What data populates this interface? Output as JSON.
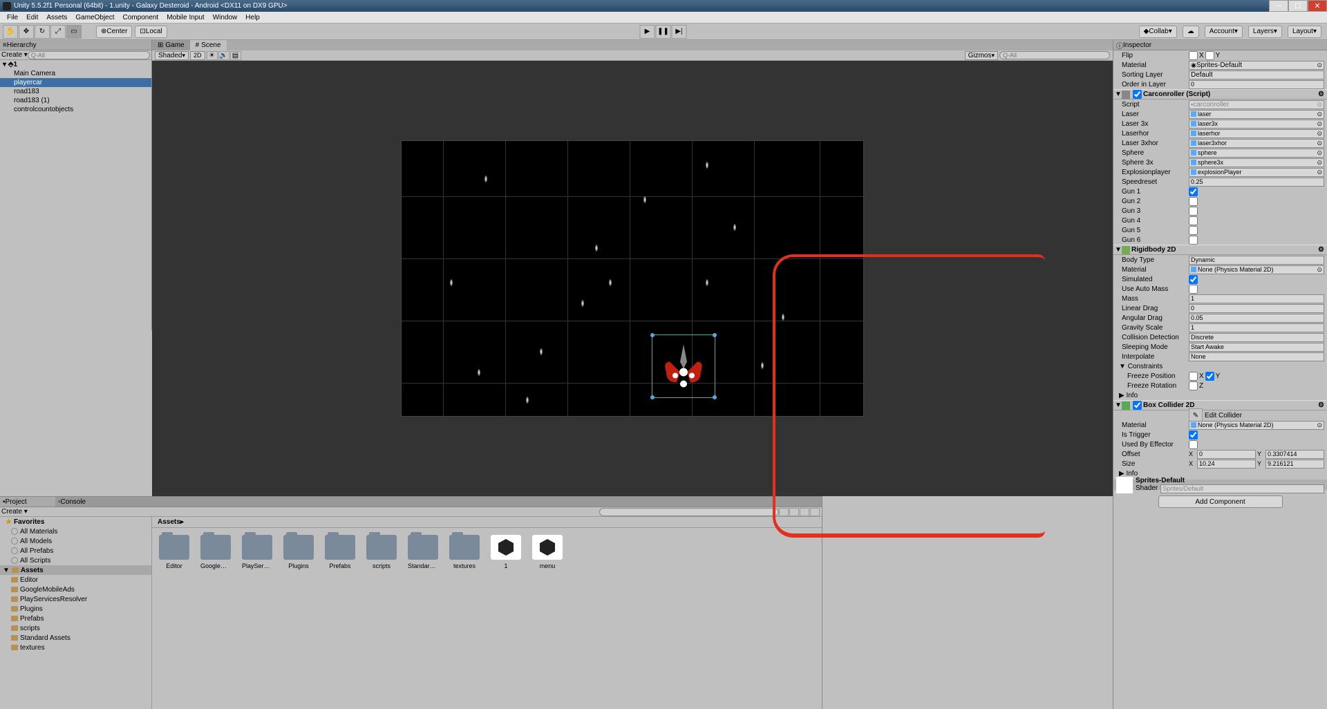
{
  "title": "Unity 5.5.2f1 Personal (64bit) - 1.unity - Galaxy Desteroid - Android <DX11 on DX9 GPU>",
  "menus": [
    "File",
    "Edit",
    "Assets",
    "GameObject",
    "Component",
    "Mobile Input",
    "Window",
    "Help"
  ],
  "toolbar": {
    "center": "Center",
    "local": "Local",
    "collab": "Collab",
    "account": "Account",
    "layers": "Layers",
    "layout": "Layout"
  },
  "hierarchy": {
    "title": "Hierarchy",
    "create": "Create",
    "search": "Q-All",
    "scene": "1",
    "items": [
      "Main Camera",
      "playercar",
      "road183",
      "road183 (1)",
      "controlcountobjects"
    ],
    "selected": 1
  },
  "scene": {
    "tabs": [
      "Game",
      "Scene"
    ],
    "active": 1,
    "shaded": "Shaded",
    "mode2d": "2D",
    "gizmos": "Gizmos",
    "search": "Q-All"
  },
  "project": {
    "title": "Project",
    "console": "Console",
    "create": "Create",
    "favorites": "Favorites",
    "favitems": [
      "All Materials",
      "All Models",
      "All Prefabs",
      "All Scripts"
    ],
    "assets": "Assets",
    "folders": [
      "Editor",
      "GoogleMobileAds",
      "PlayServicesResolver",
      "Plugins",
      "Prefabs",
      "scripts",
      "Standard Assets",
      "textures"
    ],
    "breadcrumb": "Assets",
    "griditems": [
      {
        "n": "Editor",
        "t": "folder"
      },
      {
        "n": "GoogleMobi...",
        "t": "folder"
      },
      {
        "n": "PlayServic...",
        "t": "folder"
      },
      {
        "n": "Plugins",
        "t": "folder"
      },
      {
        "n": "Prefabs",
        "t": "folder"
      },
      {
        "n": "scripts",
        "t": "folder"
      },
      {
        "n": "Standard A...",
        "t": "folder"
      },
      {
        "n": "textures",
        "t": "folder"
      },
      {
        "n": "1",
        "t": "unity"
      },
      {
        "n": "menu",
        "t": "unity"
      }
    ]
  },
  "inspector": {
    "title": "Inspector",
    "top": {
      "flip": "Flip",
      "flipX": "X",
      "flipY": "Y",
      "material": "Material",
      "materialVal": "Sprites-Default",
      "sorting": "Sorting Layer",
      "sortingVal": "Default",
      "order": "Order in Layer",
      "orderVal": "0"
    },
    "carcontroller": {
      "title": "Carconroller (Script)",
      "script": "Script",
      "scriptVal": "carconroller",
      "rows": [
        {
          "l": "Laser",
          "v": "laser",
          "obj": 1
        },
        {
          "l": "Laser 3x",
          "v": "laser3x",
          "obj": 1
        },
        {
          "l": "Laserhor",
          "v": "laserhor",
          "obj": 1
        },
        {
          "l": "Laser 3xhor",
          "v": "laser3xhor",
          "obj": 1
        },
        {
          "l": "Sphere",
          "v": "sphere",
          "obj": 1
        },
        {
          "l": "Sphere 3x",
          "v": "sphere3x",
          "obj": 1
        },
        {
          "l": "Explosionplayer",
          "v": "explosionPlayer",
          "obj": 1
        },
        {
          "l": "Speedreset",
          "v": "0.25"
        },
        {
          "l": "Gun 1",
          "cb": 1,
          "c": true
        },
        {
          "l": "Gun 2",
          "cb": 1
        },
        {
          "l": "Gun 3",
          "cb": 1
        },
        {
          "l": "Gun 4",
          "cb": 1
        },
        {
          "l": "Gun 5",
          "cb": 1
        },
        {
          "l": "Gun 6",
          "cb": 1
        }
      ]
    },
    "rigidbody": {
      "title": "Rigidbody 2D",
      "rows": [
        {
          "l": "Body Type",
          "v": "Dynamic",
          "dd": 1
        },
        {
          "l": "Material",
          "v": "None (Physics Material 2D)",
          "obj": 1
        },
        {
          "l": "Simulated",
          "cb": 1,
          "c": true
        },
        {
          "l": "Use Auto Mass",
          "cb": 1
        },
        {
          "l": "Mass",
          "v": "1"
        },
        {
          "l": "Linear Drag",
          "v": "0"
        },
        {
          "l": "Angular Drag",
          "v": "0.05"
        },
        {
          "l": "Gravity Scale",
          "v": "1"
        },
        {
          "l": "Collision Detection",
          "v": "Discrete",
          "dd": 1
        },
        {
          "l": "Sleeping Mode",
          "v": "Start Awake",
          "dd": 1
        },
        {
          "l": "Interpolate",
          "v": "None",
          "dd": 1
        }
      ],
      "constraints": "Constraints",
      "freezePos": "Freeze Position",
      "fpX": "X",
      "fpY": "Y",
      "freezeRot": "Freeze Rotation",
      "frZ": "Z",
      "info": "Info"
    },
    "boxcollider": {
      "title": "Box Collider 2D",
      "edit": "Edit Collider",
      "rows": [
        {
          "l": "Material",
          "v": "None (Physics Material 2D)",
          "obj": 1
        },
        {
          "l": "Is Trigger",
          "cb": 1,
          "c": true
        },
        {
          "l": "Used By Effector",
          "cb": 1
        }
      ],
      "offset": "Offset",
      "offX": "0",
      "offY": "0.3307414",
      "size": "Size",
      "sizeX": "10.24",
      "sizeY": "9.216121",
      "info": "Info"
    },
    "spritemat": {
      "name": "Sprites-Default",
      "shader": "Shader",
      "shaderVal": "Sprites/Default"
    },
    "addcomp": "Add Component"
  }
}
